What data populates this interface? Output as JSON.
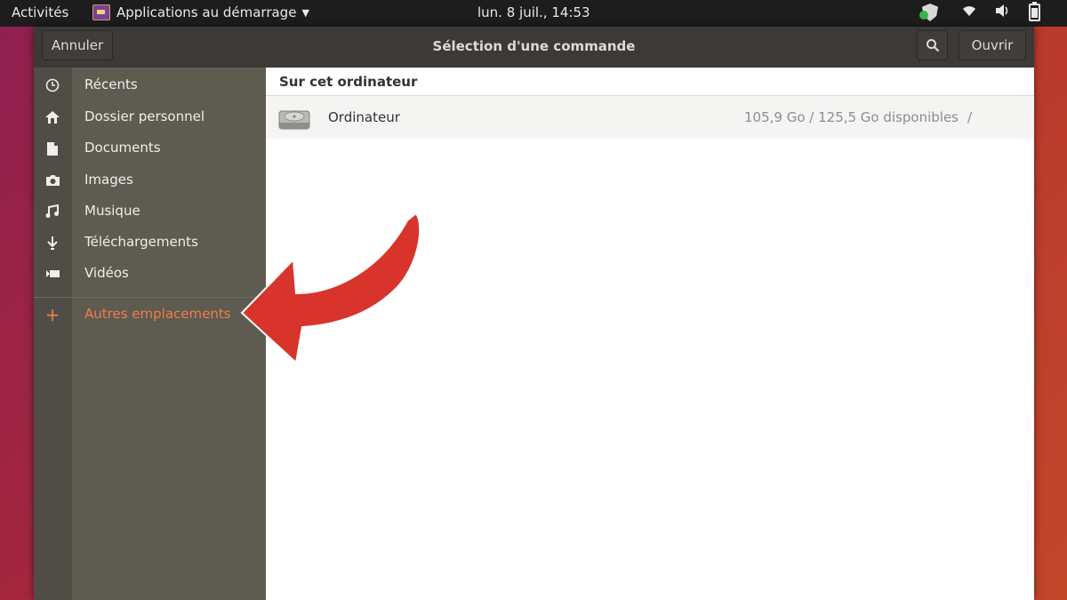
{
  "topbar": {
    "activities": "Activités",
    "app_name": "Applications au démarrage",
    "clock": "lun.  8 juil., 14:53"
  },
  "dialog": {
    "cancel_label": "Annuler",
    "title": "Sélection d'une commande",
    "open_label": "Ouvrir"
  },
  "sidebar": {
    "items": [
      {
        "label": "Récents",
        "icon": "clock-icon"
      },
      {
        "label": "Dossier personnel",
        "icon": "home-icon"
      },
      {
        "label": "Documents",
        "icon": "document-icon"
      },
      {
        "label": "Images",
        "icon": "camera-icon"
      },
      {
        "label": "Musique",
        "icon": "music-icon"
      },
      {
        "label": "Téléchargements",
        "icon": "download-icon"
      },
      {
        "label": "Vidéos",
        "icon": "video-icon"
      }
    ],
    "other_locations": {
      "label": "Autres emplacements",
      "icon": "plus-icon",
      "color": "#f37c47"
    }
  },
  "main": {
    "section_title": "Sur cet ordinateur",
    "rows": [
      {
        "name": "Ordinateur",
        "space": "105,9 Go / 125,5 Go disponibles",
        "path": "/"
      }
    ]
  },
  "annotation": {
    "arrow_color": "#d8342b"
  }
}
